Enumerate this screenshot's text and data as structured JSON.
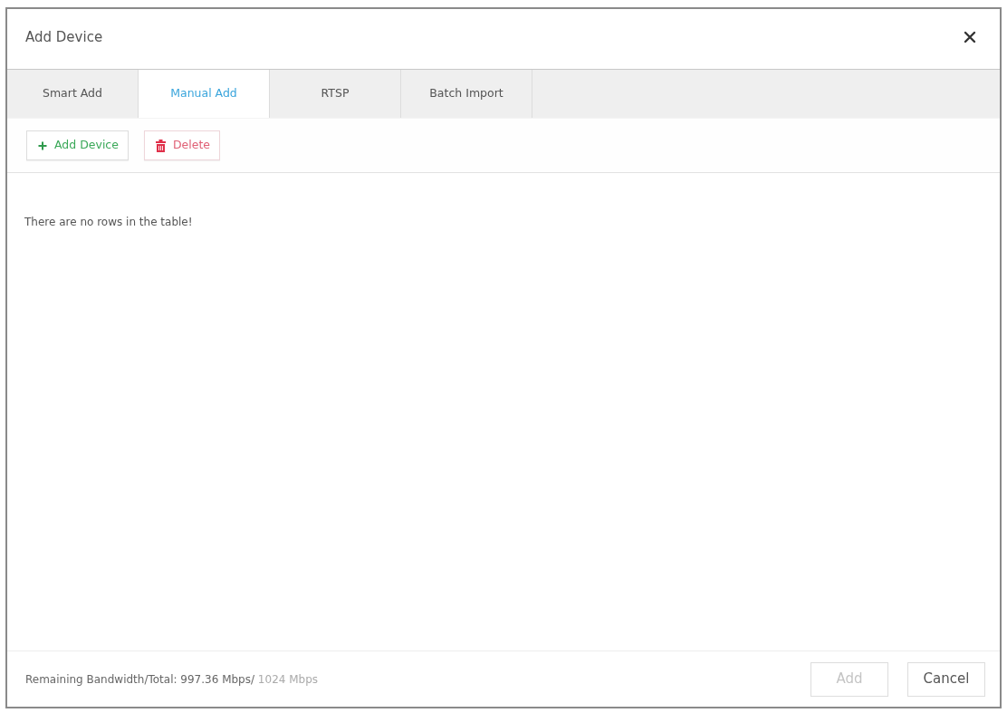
{
  "dialog": {
    "title": "Add Device"
  },
  "tabs": [
    {
      "label": "Smart Add",
      "selected": false
    },
    {
      "label": "Manual Add",
      "selected": true
    },
    {
      "label": "RTSP",
      "selected": false
    },
    {
      "label": "Batch Import",
      "selected": false
    }
  ],
  "toolbar": [
    {
      "kind": "add",
      "label": "Add Device"
    },
    {
      "kind": "delete",
      "label": "Delete"
    }
  ],
  "table": {
    "empty_message": "There are no rows in the table!"
  },
  "footer": {
    "bandwidth_label": "Remaining Bandwidth/Total: 997.36 Mbps/",
    "bandwidth_total": "1024 Mbps",
    "buttons": [
      {
        "label": "Add",
        "disabled": true
      },
      {
        "label": "Cancel",
        "disabled": false
      }
    ]
  }
}
